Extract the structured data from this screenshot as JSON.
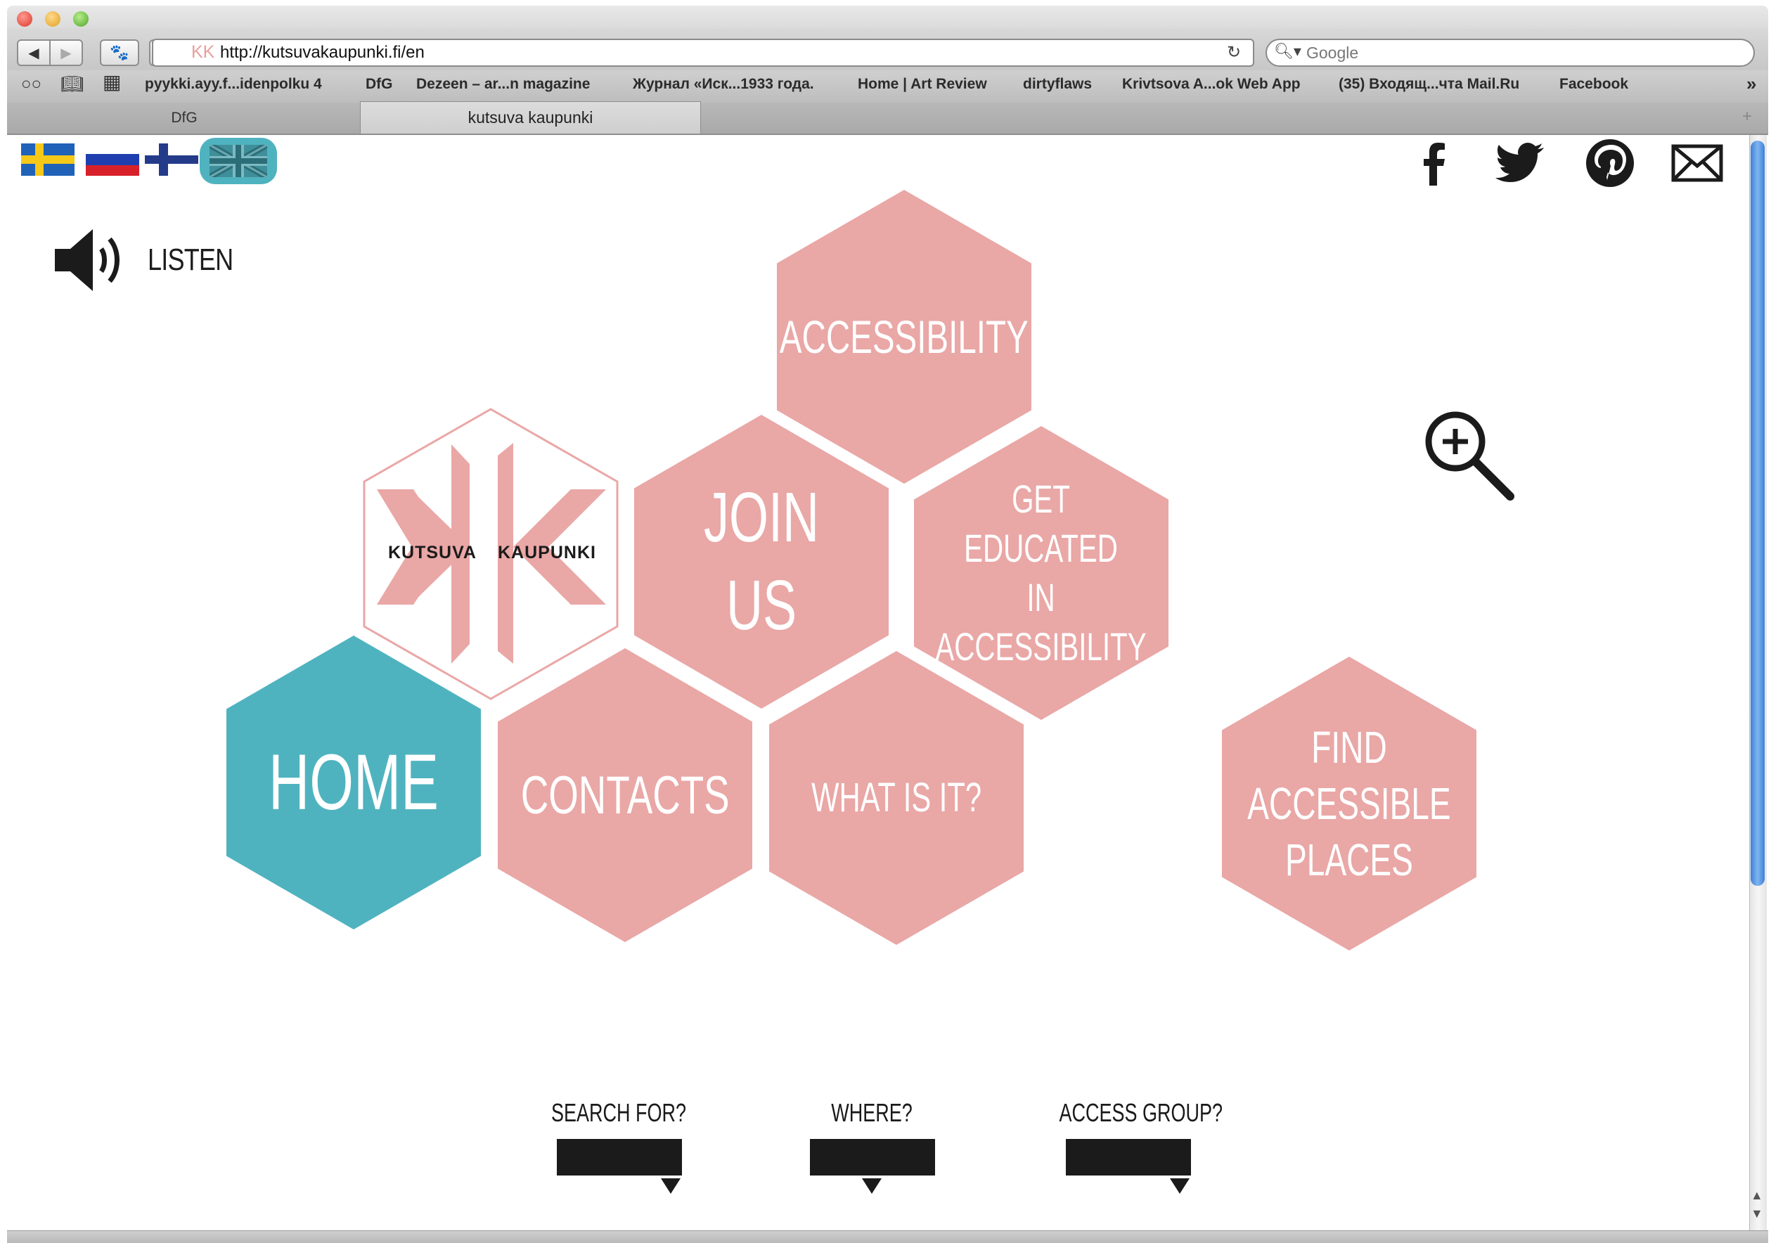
{
  "browser": {
    "url_favicon": "KK",
    "url": "http://kutsuvakaupunki.fi/en",
    "search_placeholder": "Google",
    "bookmarks": [
      "pyykki.ayy.f...idenpolku 4",
      "DfG",
      "Dezeen – ar...n magazine",
      "Журнал «Иск...1933 года.",
      "Home | Art Review",
      "dirtyflaws",
      "Krivtsova A...ok Web App",
      "(35) Входящ...чта Mail.Ru",
      "Facebook"
    ],
    "tabs": [
      "DfG",
      "kutsuva kaupunki"
    ]
  },
  "languages": [
    "swedish-flag",
    "russian-flag",
    "finnish-flag",
    "uk-flag"
  ],
  "social": [
    "facebook-icon",
    "twitter-icon",
    "pinterest-icon",
    "mail-icon"
  ],
  "listen": {
    "label": "LISTEN"
  },
  "logo": {
    "word1": "KUTSUVA",
    "word2": "KAUPUNKI"
  },
  "hexes": {
    "accessibility": "ACCESSIBILITY",
    "join_us": "JOIN US",
    "get_educated": "GET EDUCATED\nIN ACCESSIBILITY",
    "home": "HOME",
    "contacts": "CONTACTS",
    "what_is_it": "WHAT IS IT?",
    "find_places": "FIND\nACCESSIBLE\nPLACES"
  },
  "filters": {
    "search_for": "SEARCH FOR?",
    "where": "WHERE?",
    "access_group": "ACCESS GROUP?"
  },
  "colors": {
    "pink": "#e9a7a6",
    "teal": "#4fb3bf",
    "dark": "#1b1b1b"
  }
}
